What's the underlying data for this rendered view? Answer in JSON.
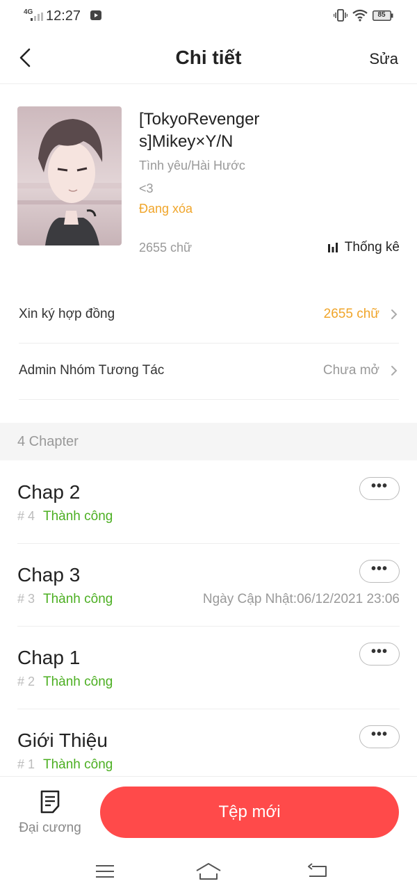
{
  "status_bar": {
    "network": "4G",
    "time": "12:27",
    "battery": "85"
  },
  "header": {
    "title": "Chi tiết",
    "edit_label": "Sửa"
  },
  "story": {
    "title": "[TokyoRevengers]Mikey×Y/N",
    "genre": "Tình yêu/Hài Hước",
    "description": "<3",
    "status": "Đang xóa",
    "word_count": "2655 chữ",
    "stats_label": "Thống kê"
  },
  "rows": [
    {
      "label": "Xin ký hợp đồng",
      "value": "2655 chữ",
      "value_color": "#f0a52a"
    },
    {
      "label": "Admin Nhóm Tương Tác",
      "value": "Chưa mở",
      "value_color": "#999999"
    }
  ],
  "chapters_section": {
    "label": "4 Chapter"
  },
  "chapters": [
    {
      "title": "Chap 2",
      "number": "# 4",
      "status": "Thành công",
      "date": ""
    },
    {
      "title": "Chap 3",
      "number": "# 3",
      "status": "Thành công",
      "date": "Ngày Cập Nhật:06/12/2021 23:06"
    },
    {
      "title": "Chap 1",
      "number": "# 2",
      "status": "Thành công",
      "date": ""
    },
    {
      "title": "Giới Thiệu",
      "number": "# 1",
      "status": "Thành công",
      "date": ""
    }
  ],
  "more_label": "•••",
  "bottom_bar": {
    "outline_label": "Đại cương",
    "new_label": "Tệp mới"
  },
  "colors": {
    "accent": "#ff4a4a",
    "warning": "#f0a52a",
    "success": "#4caf22"
  },
  "icons": [
    "back-icon",
    "stats-icon",
    "chevron-right-icon",
    "outline-icon",
    "menu-icon",
    "home-icon",
    "back-nav-icon"
  ]
}
